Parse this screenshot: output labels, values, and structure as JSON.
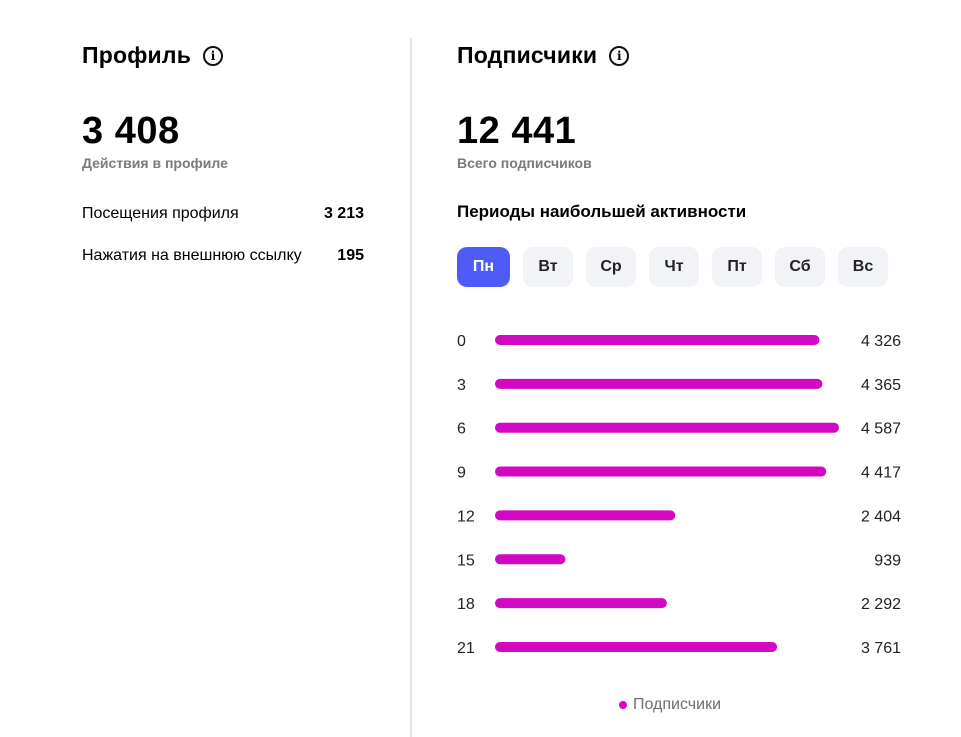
{
  "profile": {
    "title": "Профиль",
    "info_icon": "info-icon",
    "total": "3 408",
    "total_caption": "Действия в профиле",
    "stats": [
      {
        "label": "Посещения профиля",
        "value": "3 213"
      },
      {
        "label": "Нажатия на внешнюю ссылку",
        "value": "195"
      }
    ]
  },
  "subscribers": {
    "title": "Подписчики",
    "info_icon": "info-icon",
    "total": "12 441",
    "total_caption": "Всего подписчиков",
    "periods_title": "Периоды наибольшей активности",
    "days": [
      "Пн",
      "Вт",
      "Ср",
      "Чт",
      "Пт",
      "Сб",
      "Вс"
    ],
    "active_day": "Пн",
    "accent_color": "#4f5bf6",
    "bar_color": "#d208c2",
    "legend_label": "Подписчики"
  },
  "chart_data": {
    "type": "bar",
    "orientation": "horizontal",
    "categories": [
      "0",
      "3",
      "6",
      "9",
      "12",
      "15",
      "18",
      "21"
    ],
    "series": [
      {
        "name": "Подписчики",
        "values": [
          4326,
          4365,
          4587,
          4417,
          2404,
          939,
          2292,
          3761
        ]
      }
    ],
    "value_labels": [
      "4 326",
      "4 365",
      "4 587",
      "4 417",
      "2 404",
      "939",
      "2 292",
      "3 761"
    ],
    "xlim": [
      0,
      4587
    ],
    "grid": false,
    "legend_position": "bottom-center"
  }
}
